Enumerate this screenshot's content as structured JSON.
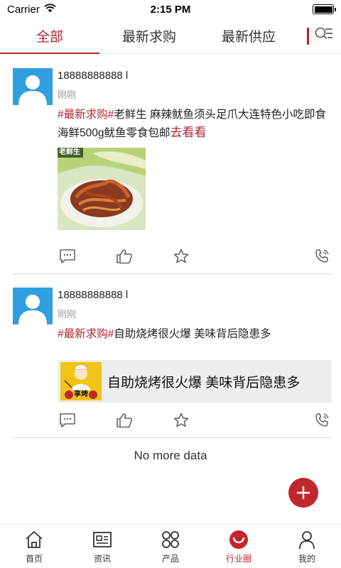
{
  "status_bar": {
    "carrier": "Carrier",
    "time": "2:15 PM"
  },
  "tabs": [
    {
      "label": "全部",
      "active": true
    },
    {
      "label": "最新求购",
      "active": false
    },
    {
      "label": "最新供应",
      "active": false
    }
  ],
  "accent_color": "#b3242f",
  "posts": [
    {
      "user": "18888888888 l",
      "time": "刚刚",
      "hashtag": "#最新求购#",
      "text": "老鲜生 麻辣鱿鱼须头足爪大连特色小吃即食海鲜500g鱿鱼零食包邮",
      "link": "去看看",
      "image_label": "老鲜生"
    },
    {
      "user": "18888888888 l",
      "time": "刚刚",
      "hashtag": "#最新求购#",
      "text": "自助烧烤很火爆 美味背后隐患多",
      "share_title": "自助烧烤很火爆 美味背后隐患多",
      "share_badge": "享烤"
    }
  ],
  "footer_text": "No more data",
  "bottom_nav": [
    {
      "label": "首页",
      "icon": "home-icon",
      "active": false
    },
    {
      "label": "资讯",
      "icon": "news-icon",
      "active": false
    },
    {
      "label": "产品",
      "icon": "products-icon",
      "active": false
    },
    {
      "label": "行业圈",
      "icon": "industry-circle-icon",
      "active": true
    },
    {
      "label": "我的",
      "icon": "profile-icon",
      "active": false
    }
  ]
}
